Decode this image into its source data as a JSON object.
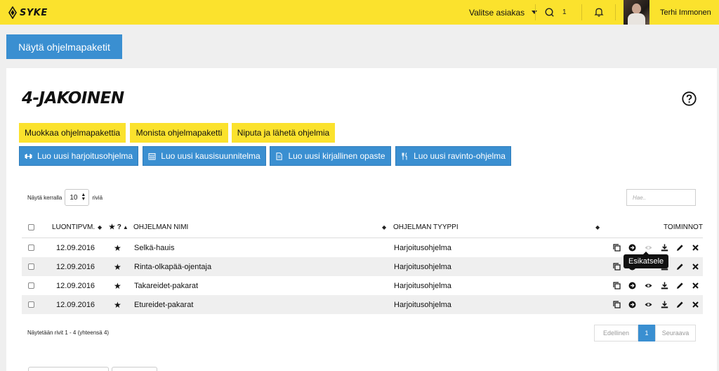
{
  "topbar": {
    "logo_text": "SYKE",
    "client_select": "Valitse asiakas",
    "search_count": "1",
    "user_name": "Terhi Immonen"
  },
  "show_packages_label": "Näytä ohjelmapaketit",
  "page_title": "4-JAKOINEN",
  "actions_primary": [
    {
      "label": "Muokkaa ohjelmapakettia"
    },
    {
      "label": "Monista ohjelmapaketti"
    },
    {
      "label": "Niputa ja lähetä ohjelmia"
    }
  ],
  "actions_create": [
    {
      "label": "Luo uusi harjoitusohjelma",
      "icon": "dumbbell-icon"
    },
    {
      "label": "Luo uusi kausisuunnitelma",
      "icon": "calendar-icon"
    },
    {
      "label": "Luo uusi kirjallinen opaste",
      "icon": "document-icon"
    },
    {
      "label": "Luo uusi ravinto-ohjelma",
      "icon": "cutlery-icon"
    }
  ],
  "table_controls": {
    "rows_prefix": "Näytä kerralla",
    "rows_value": "10",
    "rows_suffix": "riviä",
    "search_placeholder": "Hae.."
  },
  "table": {
    "headers": {
      "date": "LUONTIPVM.",
      "fav": "★ ?",
      "name": "OHJELMAN NIMI",
      "type": "OHJELMAN TYYPPI",
      "actions": "TOIMINNOT"
    },
    "rows": [
      {
        "date": "12.09.2016",
        "name": "Selkä-hauis",
        "type": "Harjoitusohjelma"
      },
      {
        "date": "12.09.2016",
        "name": "Rinta-olkapää-ojentaja",
        "type": "Harjoitusohjelma"
      },
      {
        "date": "12.09.2016",
        "name": "Takareidet-pakarat",
        "type": "Harjoitusohjelma"
      },
      {
        "date": "12.09.2016",
        "name": "Etureidet-pakarat",
        "type": "Harjoitusohjelma"
      }
    ],
    "tooltip": "Esikatsele"
  },
  "summary": "Näytetään rivit 1 - 4 (yhteensä 4)",
  "pagination": {
    "prev": "Edellinen",
    "current": "1",
    "next": "Seuraava"
  },
  "colors": {
    "brand_yellow": "#fbe22d",
    "accent_blue": "#3a8fd1"
  }
}
